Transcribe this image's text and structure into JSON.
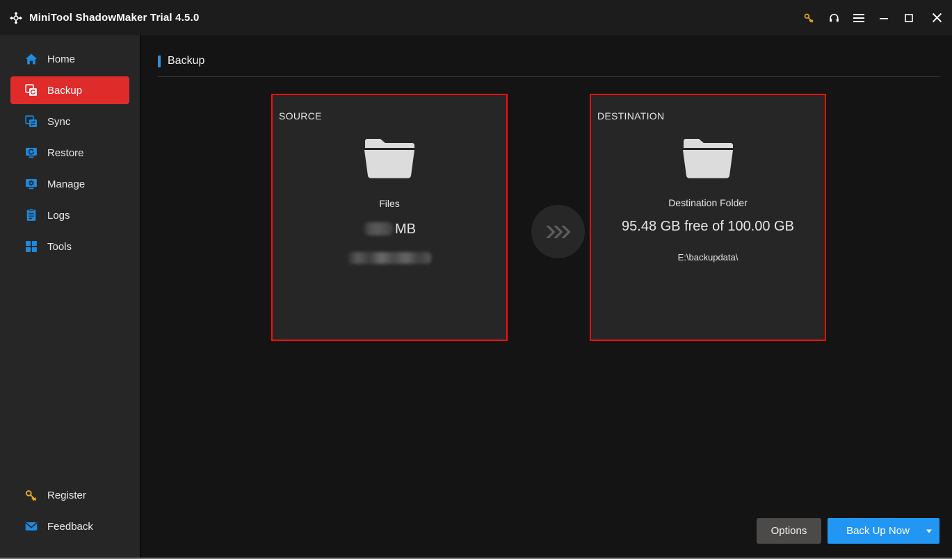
{
  "window": {
    "title": "MiniTool ShadowMaker Trial 4.5.0",
    "logo_icon": "refresh-circular-arrows-icon",
    "controls": [
      {
        "name": "key-icon",
        "label": "Register / License"
      },
      {
        "name": "headset-icon",
        "label": "Support"
      },
      {
        "name": "hamburger-menu-icon",
        "label": "Menu"
      },
      {
        "name": "minimize-icon",
        "label": "Minimize"
      },
      {
        "name": "maximize-icon",
        "label": "Maximize"
      },
      {
        "name": "close-icon",
        "label": "Close"
      }
    ]
  },
  "sidebar": {
    "items": [
      {
        "label": "Home",
        "icon": "home-icon",
        "active": false
      },
      {
        "label": "Backup",
        "icon": "backup-icon",
        "active": true
      },
      {
        "label": "Sync",
        "icon": "sync-icon",
        "active": false
      },
      {
        "label": "Restore",
        "icon": "restore-icon",
        "active": false
      },
      {
        "label": "Manage",
        "icon": "manage-icon",
        "active": false
      },
      {
        "label": "Logs",
        "icon": "logs-icon",
        "active": false
      },
      {
        "label": "Tools",
        "icon": "tools-icon",
        "active": false
      }
    ],
    "bottom_items": [
      {
        "label": "Register",
        "icon": "key-icon"
      },
      {
        "label": "Feedback",
        "icon": "envelope-icon"
      }
    ]
  },
  "page": {
    "title": "Backup",
    "accent_color": "#2f8fe0"
  },
  "source_panel": {
    "kicker": "SOURCE",
    "icon": "folder-icon",
    "name": "Files",
    "size_value": "",
    "size_unit": "MB",
    "path": "",
    "size_redacted": true,
    "path_redacted": true,
    "highlight_color": "#fc0d0d"
  },
  "transfer_indicator": {
    "icon": "triple-chevron-right-icon"
  },
  "destination_panel": {
    "kicker": "DESTINATION",
    "icon": "folder-icon",
    "name": "Destination Folder",
    "capacity": "95.48 GB free of 100.00 GB",
    "path": "E:\\backupdata\\",
    "highlight_color": "#fc0d0d"
  },
  "footer": {
    "options_label": "Options",
    "backup_label": "Back Up Now",
    "backup_color": "#2196f3"
  }
}
